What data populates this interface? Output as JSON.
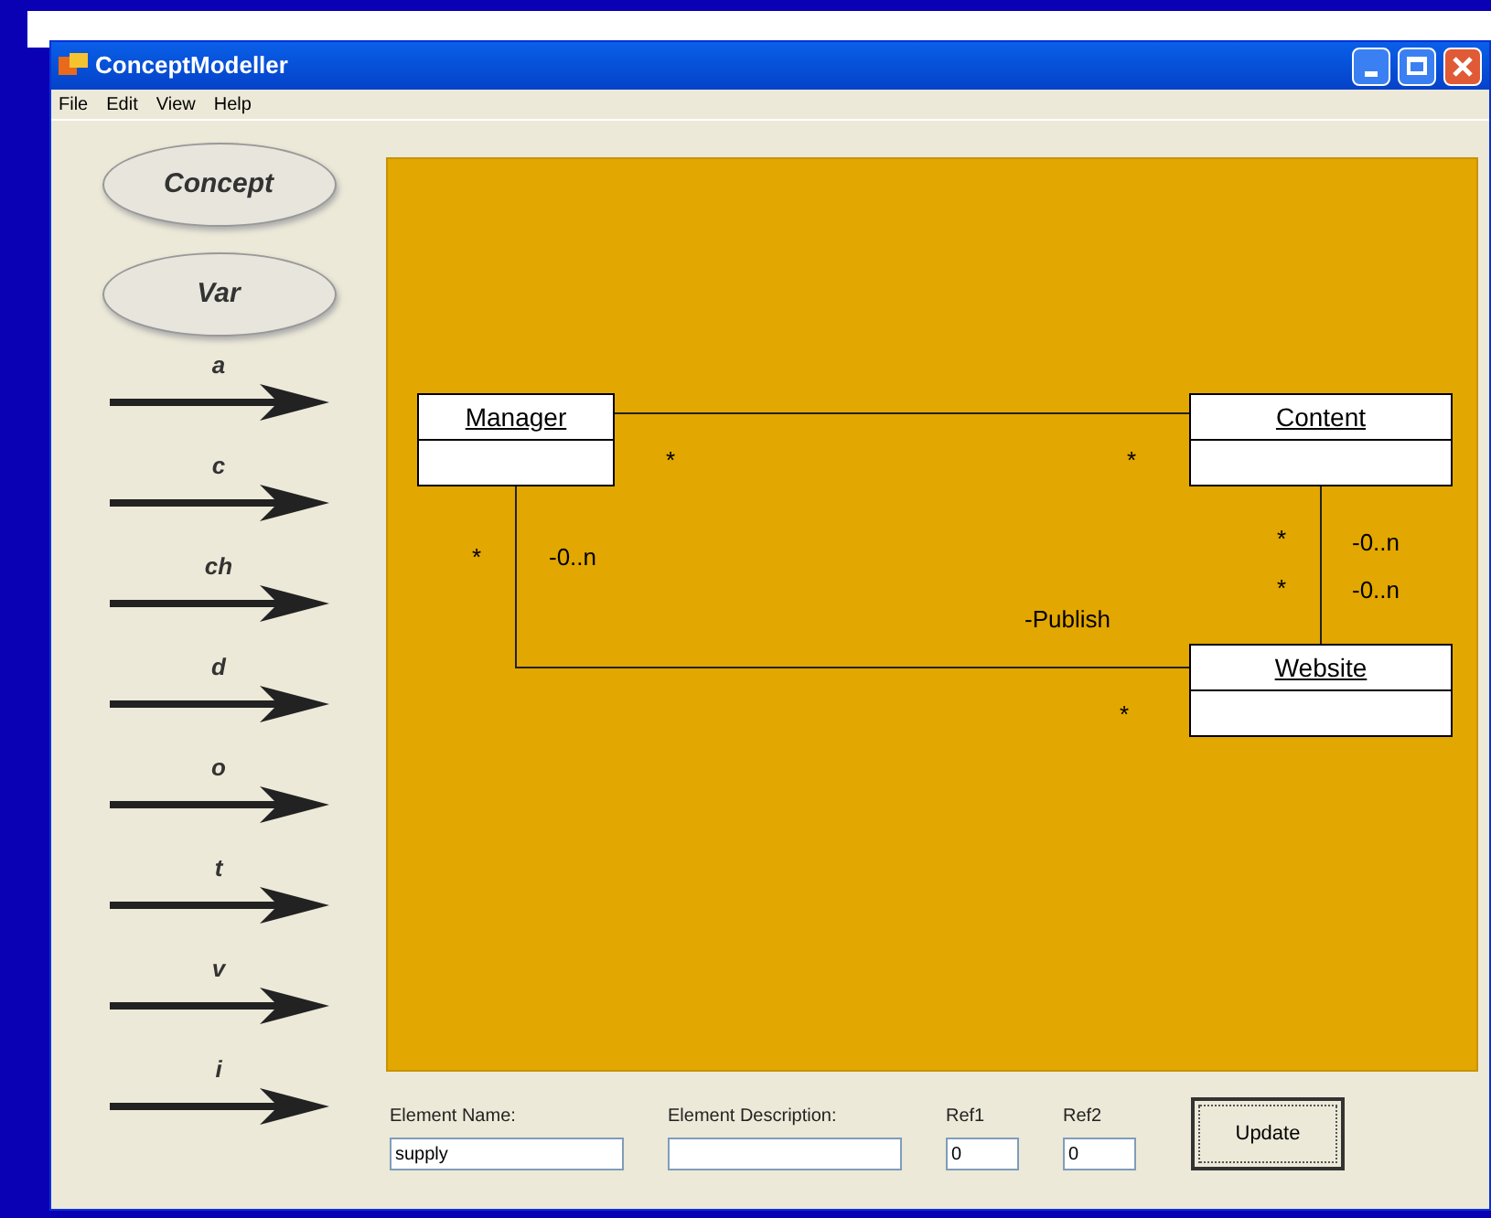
{
  "window": {
    "title": "ConceptModeller"
  },
  "menu": [
    "File",
    "Edit",
    "View",
    "Help"
  ],
  "palette": [
    {
      "kind": "ellipse",
      "label": "Concept"
    },
    {
      "kind": "ellipse",
      "label": "Var"
    },
    {
      "kind": "arrow",
      "label": "a"
    },
    {
      "kind": "arrow",
      "label": "c"
    },
    {
      "kind": "arrow",
      "label": "ch"
    },
    {
      "kind": "arrow",
      "label": "d"
    },
    {
      "kind": "arrow",
      "label": "o"
    },
    {
      "kind": "arrow",
      "label": "t"
    },
    {
      "kind": "arrow",
      "label": "v"
    },
    {
      "kind": "arrow",
      "label": "i"
    }
  ],
  "diagram": {
    "classes": [
      {
        "name": "Manager"
      },
      {
        "name": "Content"
      },
      {
        "name": "Website"
      }
    ],
    "labels": [
      "*",
      "*",
      "*",
      "-0..n",
      "*",
      "-0..n",
      "*",
      "-0..n",
      "-Publish",
      "*"
    ]
  },
  "form": {
    "fields": [
      {
        "label": "Element Name:",
        "value": "supply"
      },
      {
        "label": "Element Description:"
      },
      {
        "label": "Ref1",
        "value": "0"
      },
      {
        "label": "Ref2",
        "value": "0"
      }
    ],
    "button": "Update"
  }
}
